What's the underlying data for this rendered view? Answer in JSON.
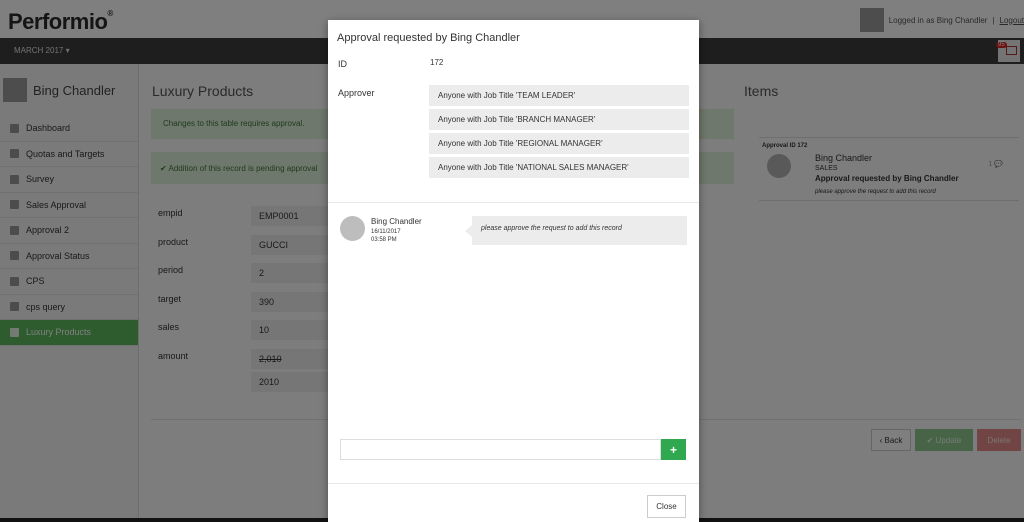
{
  "app": {
    "logo": "Performio",
    "logo_mark": "®",
    "logged_in_text": "Logged in as Bing Chandler",
    "separator": "|",
    "logout": "Logout",
    "period": "MARCH 2017 ▾",
    "notification_count": "95"
  },
  "sidebar": {
    "user_name": "Bing Chandler",
    "items": [
      {
        "label": "Dashboard"
      },
      {
        "label": "Quotas and Targets"
      },
      {
        "label": "Survey"
      },
      {
        "label": "Sales Approval"
      },
      {
        "label": "Approval 2"
      },
      {
        "label": "Approval Status"
      },
      {
        "label": "CPS"
      },
      {
        "label": "cps query"
      },
      {
        "label": "Luxury Products"
      }
    ]
  },
  "main": {
    "title": "Luxury Products",
    "alert_approval": "Changes to this table requires approval.",
    "alert_pending": "✔ Addition of this record is pending approval",
    "fields": [
      {
        "label": "empid",
        "value": "EMP0001"
      },
      {
        "label": "product",
        "value": "GUCCI"
      },
      {
        "label": "period",
        "value": "2"
      },
      {
        "label": "target",
        "value": "390"
      },
      {
        "label": "sales",
        "value": "10"
      },
      {
        "label": "amount",
        "value": "2,010",
        "value2": "2010"
      }
    ],
    "buttons": {
      "back": "‹ Back",
      "update": "✔ Update",
      "delete": "Delete"
    }
  },
  "items": {
    "title": "Items",
    "card": {
      "approval_id": "Approval ID 172",
      "name": "Bing Chandler",
      "dept": "SALES",
      "headline": "Approval requested by Bing Chandler",
      "message": "please approve the request to add this record",
      "count": "1 💬"
    }
  },
  "modal": {
    "title": "Approval requested by Bing Chandler",
    "id_label": "ID",
    "id_value": "172",
    "approver_label": "Approver",
    "approvers": [
      "Anyone with Job Title 'TEAM LEADER'",
      "Anyone with Job Title 'BRANCH MANAGER'",
      "Anyone with Job Title 'REGIONAL MANAGER'",
      "Anyone with Job Title 'NATIONAL SALES MANAGER'"
    ],
    "comment": {
      "author": "Bing Chandler",
      "date": "16/11/2017",
      "time": "03:58 PM",
      "text": "please approve the request to add this record"
    },
    "add_button": "+",
    "close_button": "Close"
  },
  "colors": {
    "accent_green": "#5cb85c",
    "add_green": "#2fa84f",
    "alert_bg": "#dff0d8",
    "navbar": "#3d3d3d"
  }
}
